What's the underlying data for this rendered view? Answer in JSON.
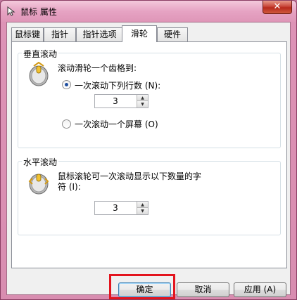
{
  "window": {
    "title": "鼠标 属性",
    "icon": "mouse-pointer-icon",
    "close_glyph": "✕"
  },
  "tabs": [
    {
      "label": "鼠标键",
      "active": false
    },
    {
      "label": "指针",
      "active": false
    },
    {
      "label": "指针选项",
      "active": false
    },
    {
      "label": "滑轮",
      "active": true
    },
    {
      "label": "硬件",
      "active": false
    }
  ],
  "vertical": {
    "group_label": "垂直滚动",
    "icon": "mouse-wheel-icon",
    "description": "滚动滑轮一个齿格到:",
    "option_lines": "一次滚动下列行数 (N):",
    "option_lines_selected": true,
    "lines_value": "3",
    "option_screen": "一次滚动一个屏幕 (O)",
    "option_screen_selected": false
  },
  "horizontal": {
    "group_label": "水平滚动",
    "icon": "mouse-wheel-icon",
    "description_line1": "鼠标滚轮可一次滚动显示以下数量的字",
    "description_line2": "符 (I):",
    "chars_value": "3"
  },
  "buttons": {
    "ok": "确定",
    "cancel": "取消",
    "apply": "应用 (A)"
  },
  "colors": {
    "highlight_box": "#e3141e",
    "title_frame": "#e6a3c3"
  }
}
